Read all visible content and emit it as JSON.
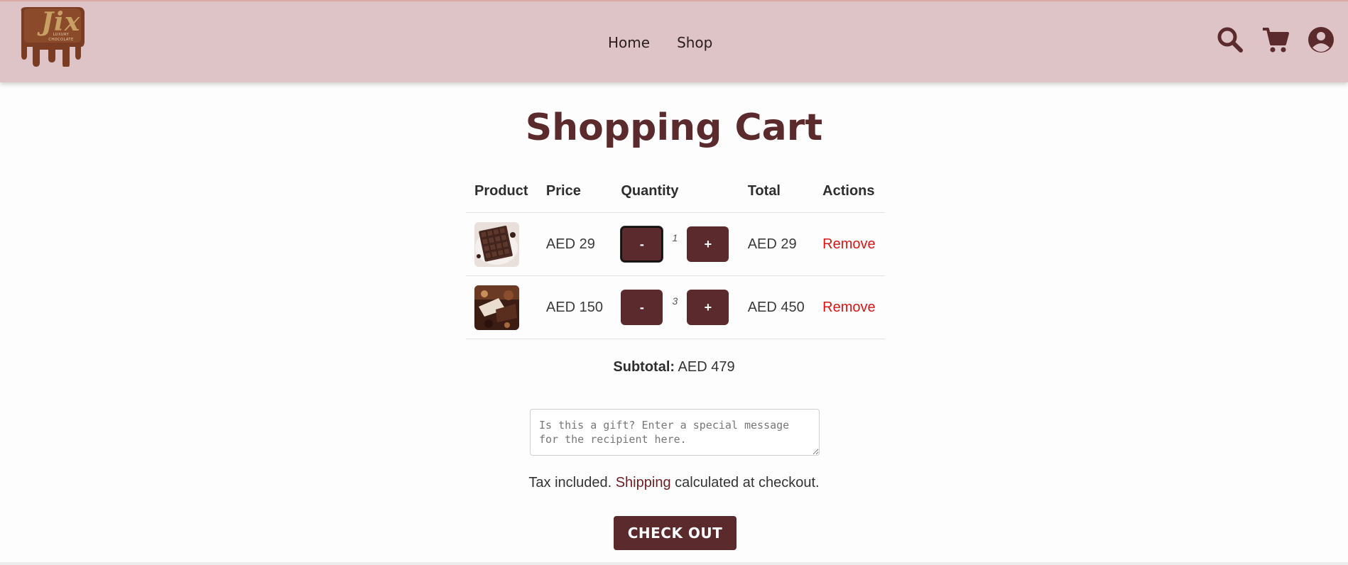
{
  "header": {
    "logo_text": "Jix",
    "logo_sub": "LUXURY CHOCOLATE",
    "nav": [
      {
        "label": "Home"
      },
      {
        "label": "Shop"
      }
    ],
    "icons": [
      "search-icon",
      "cart-icon",
      "account-icon"
    ]
  },
  "page_title": "Shopping Cart",
  "table": {
    "headers": [
      "Product",
      "Price",
      "Quantity",
      "Total",
      "Actions"
    ],
    "rows": [
      {
        "product_image": "chocolate-bar-image",
        "price": "AED 29",
        "decrement": "-",
        "quantity": "1",
        "increment": "+",
        "total": "AED 29",
        "action": "Remove"
      },
      {
        "product_image": "chocolate-assortment-image",
        "price": "AED 150",
        "decrement": "-",
        "quantity": "3",
        "increment": "+",
        "total": "AED 450",
        "action": "Remove"
      }
    ]
  },
  "subtotal": {
    "label": "Subtotal:",
    "value": "AED 479"
  },
  "gift_message": {
    "placeholder": "Is this a gift? Enter a special message for the recipient here.",
    "value": ""
  },
  "tax_note": {
    "before": "Tax included.",
    "link": "Shipping",
    "after": "calculated at checkout."
  },
  "checkout_label": "CHECK OUT",
  "colors": {
    "header_bg": "#dec4c6",
    "brand": "#5a2a2c",
    "remove": "#d41616"
  }
}
